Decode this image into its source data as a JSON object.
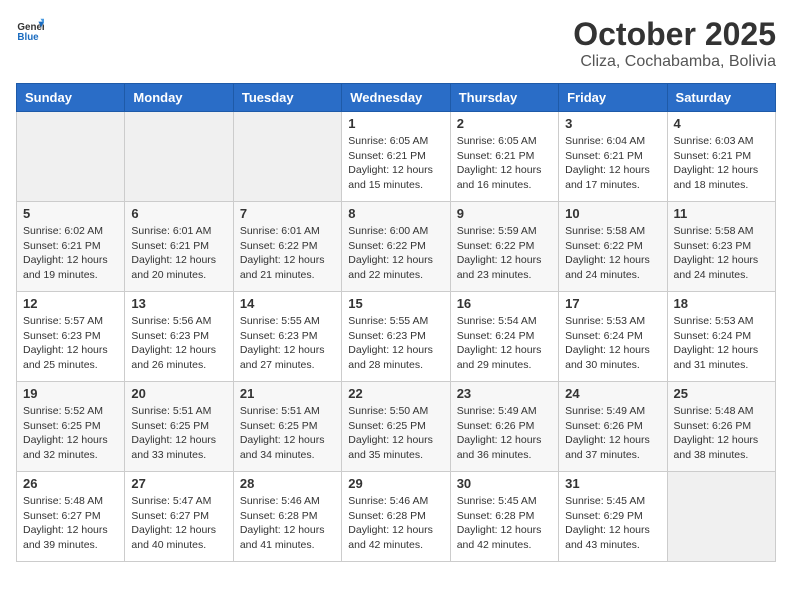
{
  "header": {
    "logo_general": "General",
    "logo_blue": "Blue",
    "month_title": "October 2025",
    "location": "Cliza, Cochabamba, Bolivia"
  },
  "weekdays": [
    "Sunday",
    "Monday",
    "Tuesday",
    "Wednesday",
    "Thursday",
    "Friday",
    "Saturday"
  ],
  "weeks": [
    [
      {
        "day": "",
        "sunrise": "",
        "sunset": "",
        "daylight": "",
        "empty": true
      },
      {
        "day": "",
        "sunrise": "",
        "sunset": "",
        "daylight": "",
        "empty": true
      },
      {
        "day": "",
        "sunrise": "",
        "sunset": "",
        "daylight": "",
        "empty": true
      },
      {
        "day": "1",
        "sunrise": "Sunrise: 6:05 AM",
        "sunset": "Sunset: 6:21 PM",
        "daylight": "Daylight: 12 hours and 15 minutes.",
        "empty": false
      },
      {
        "day": "2",
        "sunrise": "Sunrise: 6:05 AM",
        "sunset": "Sunset: 6:21 PM",
        "daylight": "Daylight: 12 hours and 16 minutes.",
        "empty": false
      },
      {
        "day": "3",
        "sunrise": "Sunrise: 6:04 AM",
        "sunset": "Sunset: 6:21 PM",
        "daylight": "Daylight: 12 hours and 17 minutes.",
        "empty": false
      },
      {
        "day": "4",
        "sunrise": "Sunrise: 6:03 AM",
        "sunset": "Sunset: 6:21 PM",
        "daylight": "Daylight: 12 hours and 18 minutes.",
        "empty": false
      }
    ],
    [
      {
        "day": "5",
        "sunrise": "Sunrise: 6:02 AM",
        "sunset": "Sunset: 6:21 PM",
        "daylight": "Daylight: 12 hours and 19 minutes.",
        "empty": false
      },
      {
        "day": "6",
        "sunrise": "Sunrise: 6:01 AM",
        "sunset": "Sunset: 6:21 PM",
        "daylight": "Daylight: 12 hours and 20 minutes.",
        "empty": false
      },
      {
        "day": "7",
        "sunrise": "Sunrise: 6:01 AM",
        "sunset": "Sunset: 6:22 PM",
        "daylight": "Daylight: 12 hours and 21 minutes.",
        "empty": false
      },
      {
        "day": "8",
        "sunrise": "Sunrise: 6:00 AM",
        "sunset": "Sunset: 6:22 PM",
        "daylight": "Daylight: 12 hours and 22 minutes.",
        "empty": false
      },
      {
        "day": "9",
        "sunrise": "Sunrise: 5:59 AM",
        "sunset": "Sunset: 6:22 PM",
        "daylight": "Daylight: 12 hours and 23 minutes.",
        "empty": false
      },
      {
        "day": "10",
        "sunrise": "Sunrise: 5:58 AM",
        "sunset": "Sunset: 6:22 PM",
        "daylight": "Daylight: 12 hours and 24 minutes.",
        "empty": false
      },
      {
        "day": "11",
        "sunrise": "Sunrise: 5:58 AM",
        "sunset": "Sunset: 6:23 PM",
        "daylight": "Daylight: 12 hours and 24 minutes.",
        "empty": false
      }
    ],
    [
      {
        "day": "12",
        "sunrise": "Sunrise: 5:57 AM",
        "sunset": "Sunset: 6:23 PM",
        "daylight": "Daylight: 12 hours and 25 minutes.",
        "empty": false
      },
      {
        "day": "13",
        "sunrise": "Sunrise: 5:56 AM",
        "sunset": "Sunset: 6:23 PM",
        "daylight": "Daylight: 12 hours and 26 minutes.",
        "empty": false
      },
      {
        "day": "14",
        "sunrise": "Sunrise: 5:55 AM",
        "sunset": "Sunset: 6:23 PM",
        "daylight": "Daylight: 12 hours and 27 minutes.",
        "empty": false
      },
      {
        "day": "15",
        "sunrise": "Sunrise: 5:55 AM",
        "sunset": "Sunset: 6:23 PM",
        "daylight": "Daylight: 12 hours and 28 minutes.",
        "empty": false
      },
      {
        "day": "16",
        "sunrise": "Sunrise: 5:54 AM",
        "sunset": "Sunset: 6:24 PM",
        "daylight": "Daylight: 12 hours and 29 minutes.",
        "empty": false
      },
      {
        "day": "17",
        "sunrise": "Sunrise: 5:53 AM",
        "sunset": "Sunset: 6:24 PM",
        "daylight": "Daylight: 12 hours and 30 minutes.",
        "empty": false
      },
      {
        "day": "18",
        "sunrise": "Sunrise: 5:53 AM",
        "sunset": "Sunset: 6:24 PM",
        "daylight": "Daylight: 12 hours and 31 minutes.",
        "empty": false
      }
    ],
    [
      {
        "day": "19",
        "sunrise": "Sunrise: 5:52 AM",
        "sunset": "Sunset: 6:25 PM",
        "daylight": "Daylight: 12 hours and 32 minutes.",
        "empty": false
      },
      {
        "day": "20",
        "sunrise": "Sunrise: 5:51 AM",
        "sunset": "Sunset: 6:25 PM",
        "daylight": "Daylight: 12 hours and 33 minutes.",
        "empty": false
      },
      {
        "day": "21",
        "sunrise": "Sunrise: 5:51 AM",
        "sunset": "Sunset: 6:25 PM",
        "daylight": "Daylight: 12 hours and 34 minutes.",
        "empty": false
      },
      {
        "day": "22",
        "sunrise": "Sunrise: 5:50 AM",
        "sunset": "Sunset: 6:25 PM",
        "daylight": "Daylight: 12 hours and 35 minutes.",
        "empty": false
      },
      {
        "day": "23",
        "sunrise": "Sunrise: 5:49 AM",
        "sunset": "Sunset: 6:26 PM",
        "daylight": "Daylight: 12 hours and 36 minutes.",
        "empty": false
      },
      {
        "day": "24",
        "sunrise": "Sunrise: 5:49 AM",
        "sunset": "Sunset: 6:26 PM",
        "daylight": "Daylight: 12 hours and 37 minutes.",
        "empty": false
      },
      {
        "day": "25",
        "sunrise": "Sunrise: 5:48 AM",
        "sunset": "Sunset: 6:26 PM",
        "daylight": "Daylight: 12 hours and 38 minutes.",
        "empty": false
      }
    ],
    [
      {
        "day": "26",
        "sunrise": "Sunrise: 5:48 AM",
        "sunset": "Sunset: 6:27 PM",
        "daylight": "Daylight: 12 hours and 39 minutes.",
        "empty": false
      },
      {
        "day": "27",
        "sunrise": "Sunrise: 5:47 AM",
        "sunset": "Sunset: 6:27 PM",
        "daylight": "Daylight: 12 hours and 40 minutes.",
        "empty": false
      },
      {
        "day": "28",
        "sunrise": "Sunrise: 5:46 AM",
        "sunset": "Sunset: 6:28 PM",
        "daylight": "Daylight: 12 hours and 41 minutes.",
        "empty": false
      },
      {
        "day": "29",
        "sunrise": "Sunrise: 5:46 AM",
        "sunset": "Sunset: 6:28 PM",
        "daylight": "Daylight: 12 hours and 42 minutes.",
        "empty": false
      },
      {
        "day": "30",
        "sunrise": "Sunrise: 5:45 AM",
        "sunset": "Sunset: 6:28 PM",
        "daylight": "Daylight: 12 hours and 42 minutes.",
        "empty": false
      },
      {
        "day": "31",
        "sunrise": "Sunrise: 5:45 AM",
        "sunset": "Sunset: 6:29 PM",
        "daylight": "Daylight: 12 hours and 43 minutes.",
        "empty": false
      },
      {
        "day": "",
        "sunrise": "",
        "sunset": "",
        "daylight": "",
        "empty": true
      }
    ]
  ]
}
